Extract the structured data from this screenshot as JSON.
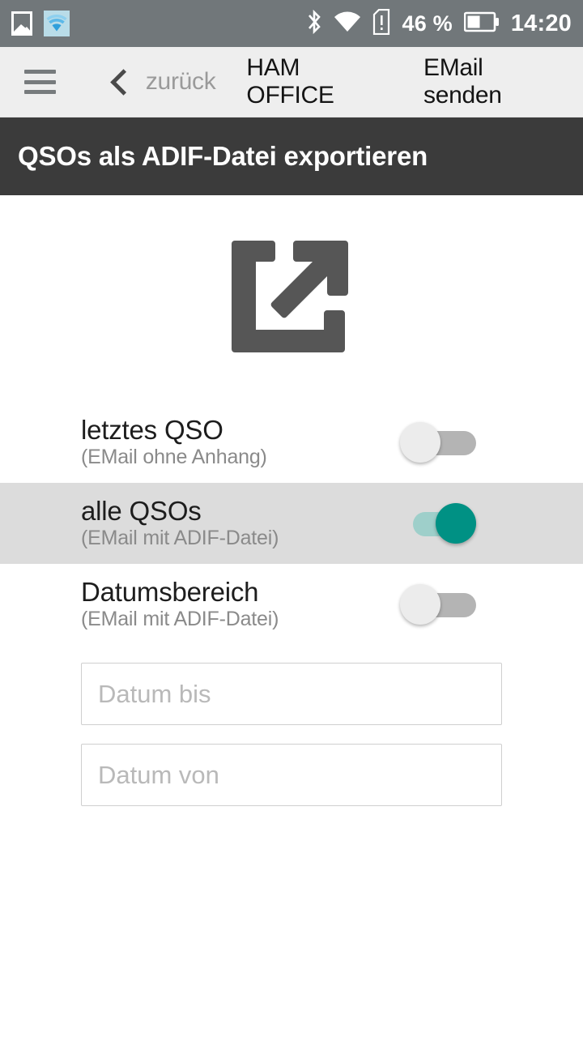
{
  "statusbar": {
    "left_icons": [
      {
        "name": "photo-icon",
        "glyph": "picture"
      },
      {
        "name": "wifi-hotspot-icon",
        "glyph": "wifi"
      }
    ],
    "bluetooth_icon": "bluetooth-icon",
    "wifi_icon": "wifi-icon",
    "sim_alert_icon": "sim-card-alert-icon",
    "battery_percent": "46 %",
    "battery_icon": "battery-half-icon",
    "clock": "14:20",
    "background_color": "#71777a",
    "foreground_color": "#ffffff"
  },
  "navbar": {
    "menu_icon": "hamburger-menu-icon",
    "back_icon": "chevron-left-icon",
    "back_label": "zurück",
    "app_title": "HAM OFFICE",
    "action_label": "EMail senden",
    "background_color": "#eeeeee"
  },
  "header": {
    "title": "QSOs als ADIF-Datei exportieren",
    "background_color": "#3b3b3b",
    "text_color": "#ffffff"
  },
  "hero": {
    "icon_name": "export-open-in-new-icon",
    "icon_color": "#565656"
  },
  "options": [
    {
      "title": "letztes QSO",
      "subtitle": "(EMail ohne Anhang)",
      "enabled": false,
      "selected": false,
      "toggle_name": "toggle-letztes-qso"
    },
    {
      "title": "alle QSOs",
      "subtitle": "(EMail mit ADIF-Datei)",
      "enabled": true,
      "selected": true,
      "toggle_name": "toggle-alle-qsos"
    },
    {
      "title": "Datumsbereich",
      "subtitle": "(EMail mit ADIF-Datei)",
      "enabled": false,
      "selected": false,
      "toggle_name": "toggle-datumsbereich"
    }
  ],
  "fields": {
    "date_to": {
      "value": "",
      "placeholder": "Datum bis"
    },
    "date_from": {
      "value": "",
      "placeholder": "Datum von"
    }
  },
  "colors": {
    "accent_on": "#009184",
    "accent_track": "#9ecfca",
    "toggle_off_track": "#b4b4b4",
    "toggle_knob": "#ececec",
    "row_selected_bg": "#dcdcdc"
  }
}
